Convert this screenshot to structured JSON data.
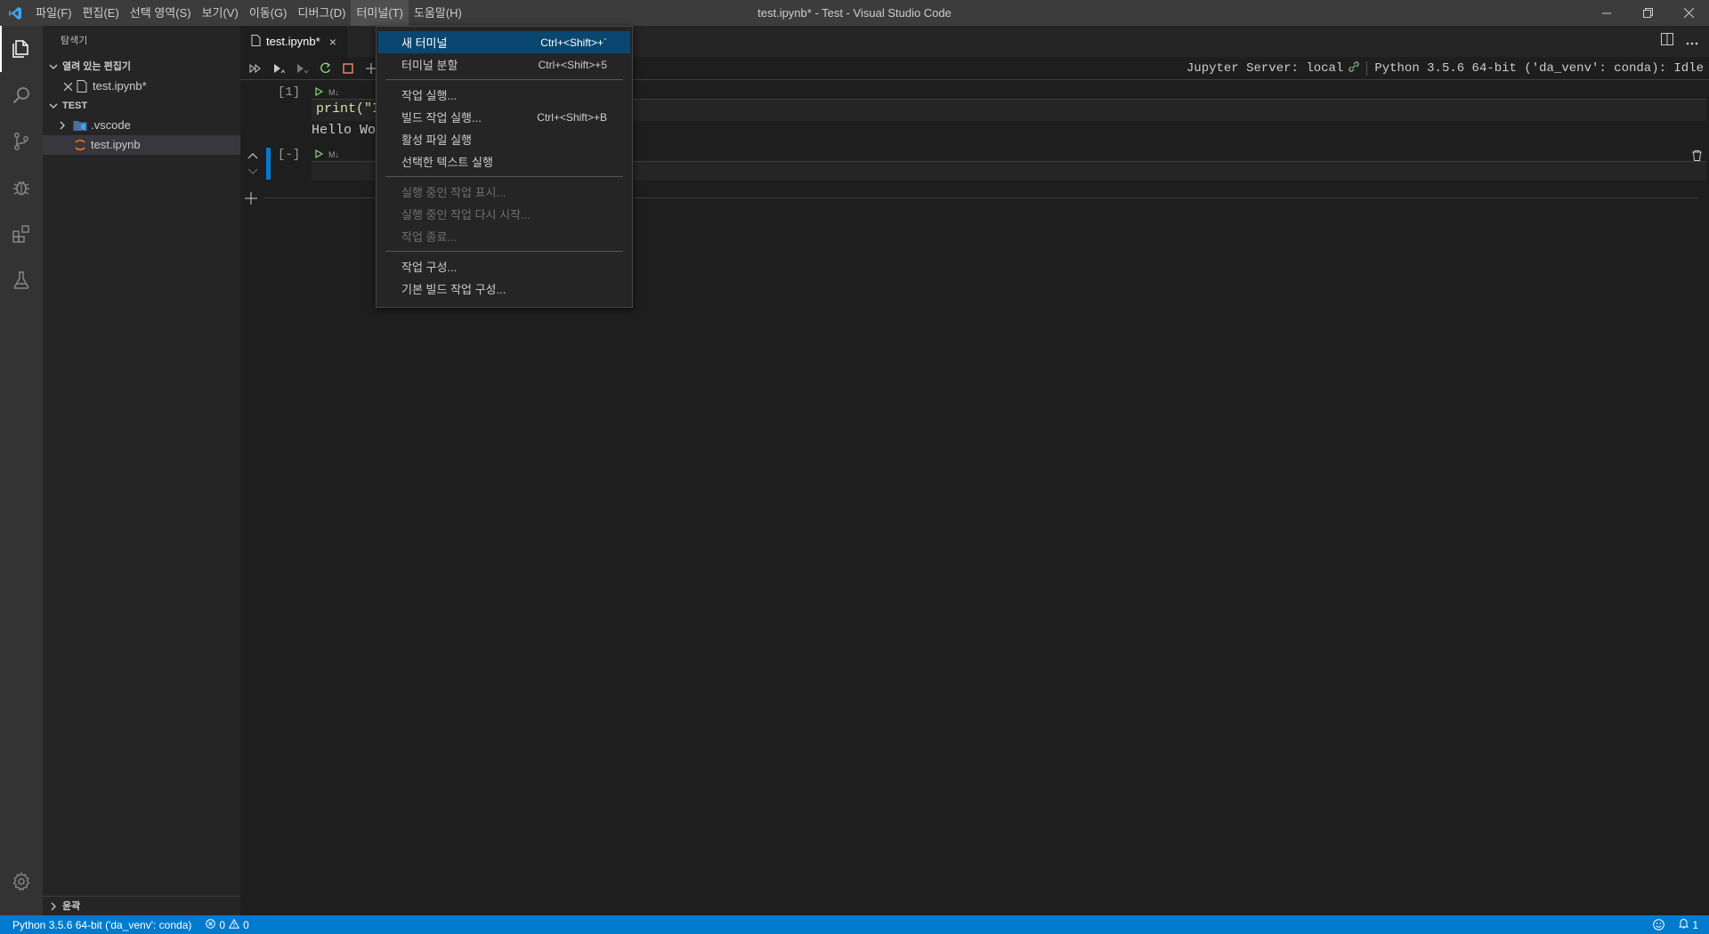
{
  "window": {
    "title": "test.ipynb* - Test - Visual Studio Code"
  },
  "menubar": {
    "items": [
      "파일(F)",
      "편집(E)",
      "선택 영역(S)",
      "보기(V)",
      "이동(G)",
      "디버그(D)",
      "터미널(T)",
      "도움말(H)"
    ]
  },
  "sidebar": {
    "title": "탐색기",
    "open_editors": {
      "label": "열려 있는 편집기",
      "files": [
        "test.ipynb*"
      ]
    },
    "folder": {
      "label": "TEST",
      "items": [
        ".vscode",
        "test.ipynb"
      ]
    },
    "outline": "윤곽"
  },
  "tab": {
    "label": "test.ipynb*",
    "close": "×"
  },
  "toolbar": {
    "jupyter_server": "Jupyter Server: local",
    "kernel": "Python 3.5.6 64-bit ('da_venv': conda): Idle"
  },
  "cells": [
    {
      "count": "[1]",
      "lang": "M↓",
      "code": "print(\"I",
      "output": "Hello Wo"
    },
    {
      "count": "[-]",
      "lang": "M↓"
    }
  ],
  "terminal_menu": {
    "group1": [
      {
        "label": "새 터미널",
        "shortcut": "Ctrl+<Shift>+`"
      },
      {
        "label": "터미널 분할",
        "shortcut": "Ctrl+<Shift>+5"
      }
    ],
    "group2": [
      {
        "label": "작업 실행...",
        "shortcut": ""
      },
      {
        "label": "빌드 작업 실행...",
        "shortcut": "Ctrl+<Shift>+B"
      },
      {
        "label": "활성 파일 실행",
        "shortcut": ""
      },
      {
        "label": "선택한 텍스트 실행",
        "shortcut": ""
      }
    ],
    "group3": [
      {
        "label": "실행 중인 작업 표시..."
      },
      {
        "label": "실행 중인 작업 다시 시작..."
      },
      {
        "label": "작업 종료..."
      }
    ],
    "group4": [
      {
        "label": "작업 구성..."
      },
      {
        "label": "기본 빌드 작업 구성..."
      }
    ]
  },
  "statusbar": {
    "interpreter": "Python 3.5.6 64-bit ('da_venv': conda)",
    "errors": "0",
    "warnings": "0",
    "notifications": "1"
  },
  "colors": {
    "accent": "#007acc",
    "menu_highlight": "#094771"
  }
}
